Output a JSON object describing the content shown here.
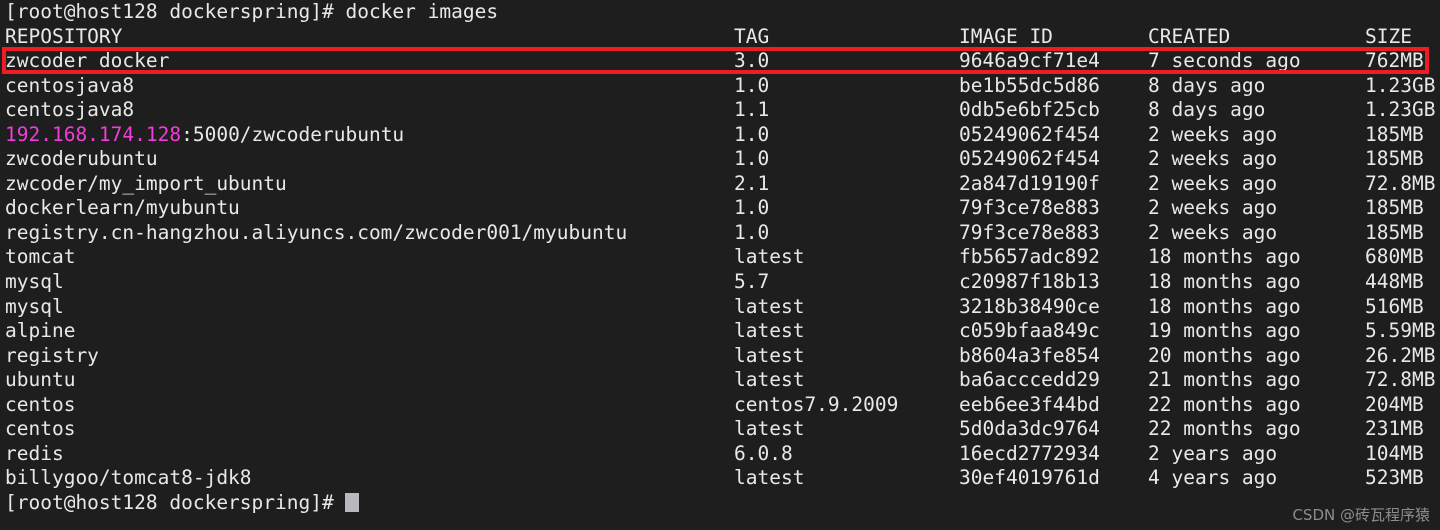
{
  "terminal": {
    "background_color": "#1e1e1e",
    "foreground_color": "#e8e8e8",
    "magenta_color": "#f23ddb",
    "highlight_color": "#ee1c24",
    "cursor_color": "#b8b8c0",
    "command_line": "[root@host128 dockerspring]# docker images",
    "prompt_trailing": "[root@host128 dockerspring]# "
  },
  "header": {
    "repository": "REPOSITORY",
    "tag": "TAG",
    "image_id": "IMAGE ID",
    "created": "CREATED",
    "size": "SIZE"
  },
  "rows": [
    {
      "repository": "zwcoder_docker",
      "repository_prefix": "",
      "tag": "3.0",
      "image_id": "9646a9cf71e4",
      "created": "7 seconds ago",
      "size": "762MB",
      "highlighted": true
    },
    {
      "repository": "centosjava8",
      "repository_prefix": "",
      "tag": "1.0",
      "image_id": "be1b55dc5d86",
      "created": "8 days ago",
      "size": "1.23GB",
      "highlighted": false
    },
    {
      "repository": "centosjava8",
      "repository_prefix": "",
      "tag": "1.1",
      "image_id": "0db5e6bf25cb",
      "created": "8 days ago",
      "size": "1.23GB",
      "highlighted": false
    },
    {
      "repository": ":5000/zwcoderubuntu",
      "repository_prefix": "192.168.174.128",
      "tag": "1.0",
      "image_id": "05249062f454",
      "created": "2 weeks ago",
      "size": "185MB",
      "highlighted": false
    },
    {
      "repository": "zwcoderubuntu",
      "repository_prefix": "",
      "tag": "1.0",
      "image_id": "05249062f454",
      "created": "2 weeks ago",
      "size": "185MB",
      "highlighted": false
    },
    {
      "repository": "zwcoder/my_import_ubuntu",
      "repository_prefix": "",
      "tag": "2.1",
      "image_id": "2a847d19190f",
      "created": "2 weeks ago",
      "size": "72.8MB",
      "highlighted": false
    },
    {
      "repository": "dockerlearn/myubuntu",
      "repository_prefix": "",
      "tag": "1.0",
      "image_id": "79f3ce78e883",
      "created": "2 weeks ago",
      "size": "185MB",
      "highlighted": false
    },
    {
      "repository": "registry.cn-hangzhou.aliyuncs.com/zwcoder001/myubuntu",
      "repository_prefix": "",
      "tag": "1.0",
      "image_id": "79f3ce78e883",
      "created": "2 weeks ago",
      "size": "185MB",
      "highlighted": false
    },
    {
      "repository": "tomcat",
      "repository_prefix": "",
      "tag": "latest",
      "image_id": "fb5657adc892",
      "created": "18 months ago",
      "size": "680MB",
      "highlighted": false
    },
    {
      "repository": "mysql",
      "repository_prefix": "",
      "tag": "5.7",
      "image_id": "c20987f18b13",
      "created": "18 months ago",
      "size": "448MB",
      "highlighted": false
    },
    {
      "repository": "mysql",
      "repository_prefix": "",
      "tag": "latest",
      "image_id": "3218b38490ce",
      "created": "18 months ago",
      "size": "516MB",
      "highlighted": false
    },
    {
      "repository": "alpine",
      "repository_prefix": "",
      "tag": "latest",
      "image_id": "c059bfaa849c",
      "created": "19 months ago",
      "size": "5.59MB",
      "highlighted": false
    },
    {
      "repository": "registry",
      "repository_prefix": "",
      "tag": "latest",
      "image_id": "b8604a3fe854",
      "created": "20 months ago",
      "size": "26.2MB",
      "highlighted": false
    },
    {
      "repository": "ubuntu",
      "repository_prefix": "",
      "tag": "latest",
      "image_id": "ba6acccedd29",
      "created": "21 months ago",
      "size": "72.8MB",
      "highlighted": false
    },
    {
      "repository": "centos",
      "repository_prefix": "",
      "tag": "centos7.9.2009",
      "image_id": "eeb6ee3f44bd",
      "created": "22 months ago",
      "size": "204MB",
      "highlighted": false
    },
    {
      "repository": "centos",
      "repository_prefix": "",
      "tag": "latest",
      "image_id": "5d0da3dc9764",
      "created": "22 months ago",
      "size": "231MB",
      "highlighted": false
    },
    {
      "repository": "redis",
      "repository_prefix": "",
      "tag": "6.0.8",
      "image_id": "16ecd2772934",
      "created": "2 years ago",
      "size": "104MB",
      "highlighted": false
    },
    {
      "repository": "billygoo/tomcat8-jdk8",
      "repository_prefix": "",
      "tag": "latest",
      "image_id": "30ef4019761d",
      "created": "4 years ago",
      "size": "523MB",
      "highlighted": false
    }
  ],
  "watermark": "CSDN @砖瓦程序猿"
}
